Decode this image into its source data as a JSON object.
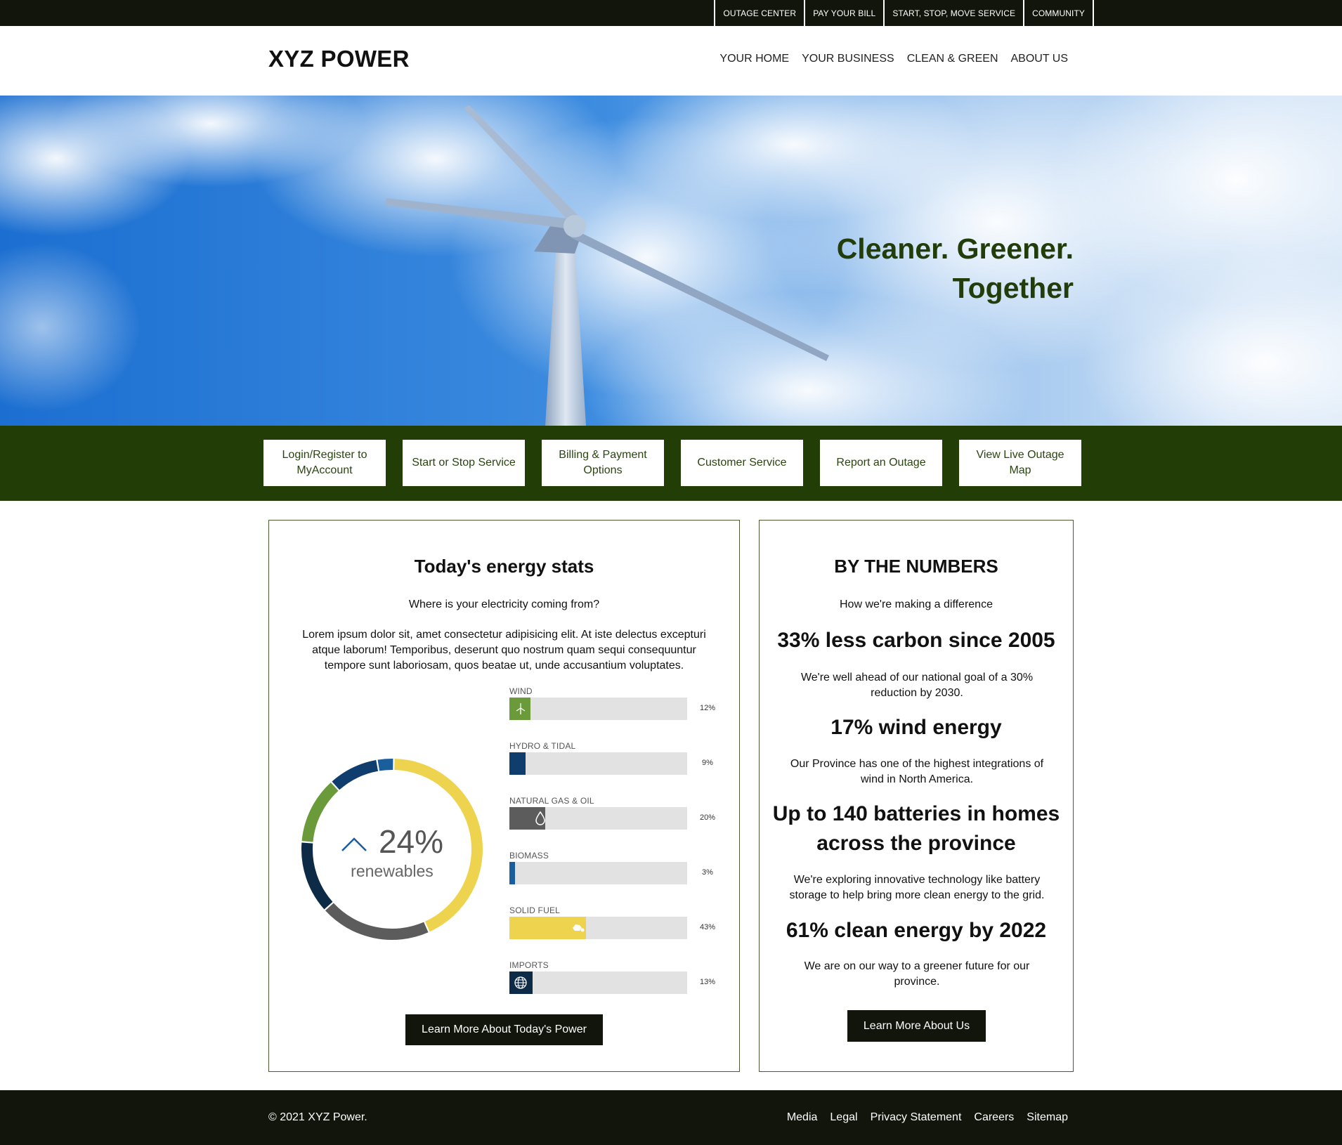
{
  "utility_nav": [
    "OUTAGE CENTER",
    "PAY YOUR BILL",
    "START, STOP, MOVE SERVICE",
    "COMMUNITY"
  ],
  "header": {
    "logo": "XYZ POWER",
    "nav": [
      "YOUR HOME",
      "YOUR BUSINESS",
      "CLEAN & GREEN",
      "ABOUT US"
    ]
  },
  "hero": {
    "tagline_line1": "Cleaner. Greener.",
    "tagline_line2": "Together"
  },
  "quick_links": [
    "Login/Register to MyAccount",
    "Start or Stop Service",
    "Billing & Payment Options",
    "Customer Service",
    "Report an Outage",
    "View Live Outage Map"
  ],
  "energy_stats": {
    "title": "Today's energy stats",
    "subtitle": "Where is your electricity coming from?",
    "paragraph": "Lorem ipsum dolor sit, amet consectetur adipisicing elit. At iste delectus excepturi atque laborum! Temporibus, deserunt quo nostrum quam sequi consequuntur tempore sunt laboriosam, quos beatae ut, unde accusantium voluptates.",
    "renewables_pct": "24%",
    "renewables_label": "renewables",
    "button": "Learn More About Today's Power"
  },
  "chart_data": {
    "type": "bar",
    "categories": [
      "WIND",
      "HYDRO & TIDAL",
      "NATURAL GAS & OIL",
      "BIOMASS",
      "SOLID FUEL",
      "IMPORTS"
    ],
    "values": [
      12,
      9,
      20,
      3,
      43,
      13
    ],
    "value_labels": [
      "12%",
      "9%",
      "20%",
      "3%",
      "43%",
      "13%"
    ],
    "colors": [
      "#6a9a3a",
      "#0f3d6e",
      "#5c5c5c",
      "#1a5e9e",
      "#eed44e",
      "#0d2a47"
    ],
    "icons": [
      "wind-turbine-icon",
      "",
      "droplet-icon",
      "",
      "coal-icon",
      "globe-icon"
    ],
    "donut": {
      "segments": [
        {
          "name": "SOLID FUEL",
          "value": 43,
          "color": "#eed44e"
        },
        {
          "name": "NATURAL GAS & OIL",
          "value": 20,
          "color": "#5c5c5c"
        },
        {
          "name": "IMPORTS",
          "value": 13,
          "color": "#0d2a47"
        },
        {
          "name": "WIND",
          "value": 12,
          "color": "#6a9a3a"
        },
        {
          "name": "HYDRO & TIDAL",
          "value": 9,
          "color": "#0f3d6e"
        },
        {
          "name": "BIOMASS",
          "value": 3,
          "color": "#1a5e9e"
        }
      ]
    }
  },
  "by_numbers": {
    "title": "BY THE NUMBERS",
    "subtitle": "How we're making a difference",
    "stats": [
      {
        "heading": "33% less carbon since 2005",
        "text": "We're well ahead of our national goal of a 30% reduction by 2030."
      },
      {
        "heading": "17% wind energy",
        "text": "Our Province has one of the highest integrations of wind in North America."
      },
      {
        "heading": "Up to 140 batteries in homes across the province",
        "text": "We're exploring innovative technology like battery storage to help bring more clean energy to the grid."
      },
      {
        "heading": "61% clean energy by 2022",
        "text": "We are on our way to a greener future for our province."
      }
    ],
    "button": "Learn More About Us"
  },
  "footer": {
    "copyright": "© 2021 XYZ Power.",
    "links": [
      "Media",
      "Legal",
      "Privacy Statement",
      "Careers",
      "Sitemap"
    ]
  }
}
